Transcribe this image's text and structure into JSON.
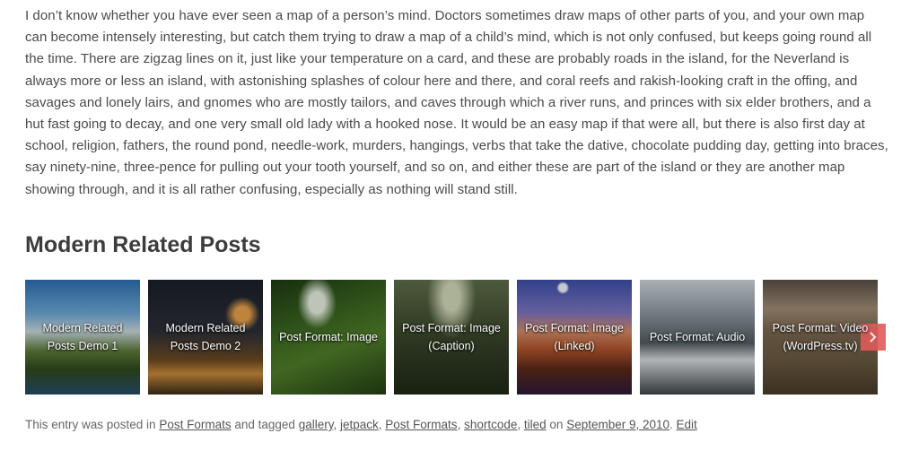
{
  "article": {
    "paragraph": "I don’t know whether you have ever seen a map of a person’s mind. Doctors sometimes draw maps of other parts of you, and your own map can become intensely interesting, but catch them trying to draw a map of a child’s mind, which is not only confused, but keeps going round all the time. There are zigzag lines on it, just like your temperature on a card, and these are probably roads in the island, for the Neverland is always more or less an island, with astonishing splashes of colour here and there, and coral reefs and rakish-looking craft in the offing, and savages and lonely lairs, and gnomes who are mostly tailors, and caves through which a river runs, and princes with six elder brothers, and a hut fast going to decay, and one very small old lady with a hooked nose. It would be an easy map if that were all, but there is also first day at school, religion, fathers, the round pond, needle-work, murders, hangings, verbs that take the dative, chocolate pudding day, getting into braces, say ninety-nine, three-pence for pulling out your tooth yourself, and so on, and either these are part of the island or they are another map showing through, and it is all rather confusing, especially as nothing will stand still."
  },
  "related": {
    "title": "Modern Related Posts",
    "posts": [
      {
        "label": "Modern Related Posts Demo 1"
      },
      {
        "label": "Modern Related Posts Demo 2"
      },
      {
        "label": "Post Format: Image"
      },
      {
        "label": "Post Format: Image (Caption)"
      },
      {
        "label": "Post Format: Image (Linked)"
      },
      {
        "label": "Post Format: Audio"
      },
      {
        "label": "Post Format: Video (WordPress.tv)"
      }
    ],
    "next_icon": "chevron-right-icon",
    "accent_color": "#e05a5a"
  },
  "meta": {
    "prefix": "This entry was posted in ",
    "category": "Post Formats",
    "tagged_text": " and tagged ",
    "tags": [
      "gallery",
      "jetpack",
      "Post Formats",
      "shortcode",
      "tiled"
    ],
    "separator": ", ",
    "on_text": " on ",
    "date": "September 9, 2010",
    "period": ". ",
    "edit_label": "Edit"
  }
}
